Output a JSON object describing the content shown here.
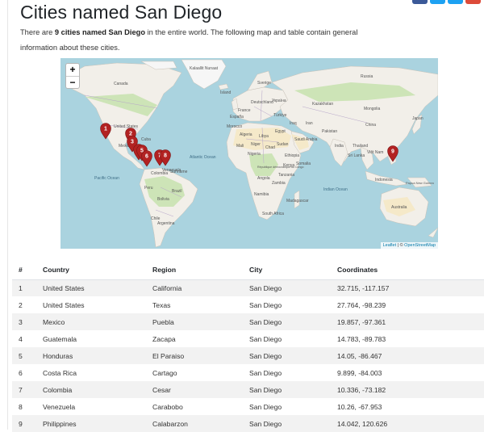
{
  "page": {
    "title": "Cities named San Diego",
    "intro_prefix": "There are ",
    "intro_bold": "9 cities named San Diego",
    "intro_suffix": " in the entire world. The following map and table contain general information about these cities."
  },
  "share_colors": [
    "#3b5998",
    "#1da1f2",
    "#1da1f2",
    "#dd4b39"
  ],
  "map": {
    "zoom_in": "+",
    "zoom_out": "−",
    "attribution_leaflet": "Leaflet",
    "attribution_separator": " | © ",
    "attribution_osm": "OpenStreetMap",
    "colors": {
      "water": "#aad3df",
      "land": "#f2efe9",
      "forest": "#cde4b7",
      "desert": "#f5e9c9",
      "ice": "#f6f6f6",
      "border": "#b7a6c9",
      "marker": "#b22222"
    },
    "markers": [
      "1",
      "2",
      "3",
      "4",
      "5",
      "6",
      "7",
      "8",
      "9"
    ],
    "labels": {
      "russia": "Russia",
      "canada": "Canada",
      "united_states": "United States",
      "mexico": "Mexico",
      "brazil": "Brazil",
      "peru": "Peru",
      "chile": "Chile",
      "argentina": "Argentina",
      "bolivia": "Bolivia",
      "colombia": "Colombia",
      "pacific_ocean": "Pacific Ocean",
      "atlantic_ocean": "Atlantic Ocean",
      "indian_ocean": "Indian Ocean",
      "algeria": "Algeria",
      "libya": "Libya",
      "egypt": "Egypt",
      "mali": "Mali",
      "niger": "Niger",
      "chad": "Chad",
      "sudan": "Sudan",
      "nigeria": "Nigeria",
      "ethiopia": "Ethiopia",
      "kenya": "Kenya",
      "angola": "Angola",
      "namibia": "Namibia",
      "south_africa": "South Africa",
      "madagascar": "Madagascar",
      "saudi_arabia": "Saudi Arabia",
      "iran": "Iran",
      "india": "India",
      "china": "China",
      "mongolia": "Mongolia",
      "kazakhstan": "Kazakhstan",
      "japan": "Japan",
      "australia": "Australia",
      "indonesia": "Indonesia",
      "turkey": "Türkiye",
      "germany": "Deutschland",
      "france": "France",
      "spain": "España",
      "sweden": "Sverige",
      "iceland": "Ísland",
      "morocco": "Morocco",
      "thailand": "Thailand",
      "vietnam": "Việt Nam",
      "papua": "Papua New Guinea",
      "suriname": "Suriname",
      "sri_lanka": "Sri Lanka",
      "somalia": "Somalia",
      "dr_congo": "République démocratique du Congo",
      "tanzania": "Tanzania",
      "zambia": "Zambia",
      "cuba": "Cuba",
      "venezuela": "Venezuela",
      "pakistan": "Pakistan",
      "iraq": "Iraq",
      "greenland": "Kalaallit Nunaat",
      "ukraine": "Україна"
    }
  },
  "table": {
    "headers": [
      "#",
      "Country",
      "Region",
      "City",
      "Coordinates"
    ],
    "rows": [
      [
        "1",
        "United States",
        "California",
        "San Diego",
        "32.715, -117.157"
      ],
      [
        "2",
        "United States",
        "Texas",
        "San Diego",
        "27.764, -98.239"
      ],
      [
        "3",
        "Mexico",
        "Puebla",
        "San Diego",
        "19.857, -97.361"
      ],
      [
        "4",
        "Guatemala",
        "Zacapa",
        "San Diego",
        "14.783, -89.783"
      ],
      [
        "5",
        "Honduras",
        "El Paraiso",
        "San Diego",
        "14.05, -86.467"
      ],
      [
        "6",
        "Costa Rica",
        "Cartago",
        "San Diego",
        "9.899, -84.003"
      ],
      [
        "7",
        "Colombia",
        "Cesar",
        "San Diego",
        "10.336, -73.182"
      ],
      [
        "8",
        "Venezuela",
        "Carabobo",
        "San Diego",
        "10.26, -67.953"
      ],
      [
        "9",
        "Philippines",
        "Calabarzon",
        "San Diego",
        "14.042, 120.626"
      ]
    ]
  }
}
